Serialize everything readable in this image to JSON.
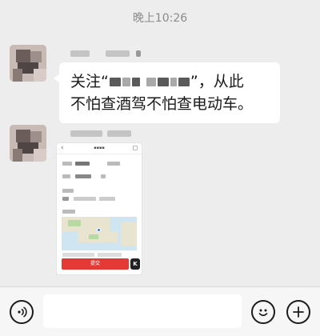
{
  "status": {
    "time": "晚上10:26"
  },
  "messages": [
    {
      "type": "text",
      "line1_prefix": "关注“",
      "line1_suffix": "”，从此",
      "line2": "不怕查酒驾不怕查电动车。"
    },
    {
      "type": "image",
      "preview": {
        "red_button_label": "提交",
        "fab_label": "K"
      }
    }
  ],
  "input_bar": {
    "voice_icon": "voice-icon",
    "emoji_icon": "emoji-icon",
    "plus_icon": "plus-icon"
  }
}
